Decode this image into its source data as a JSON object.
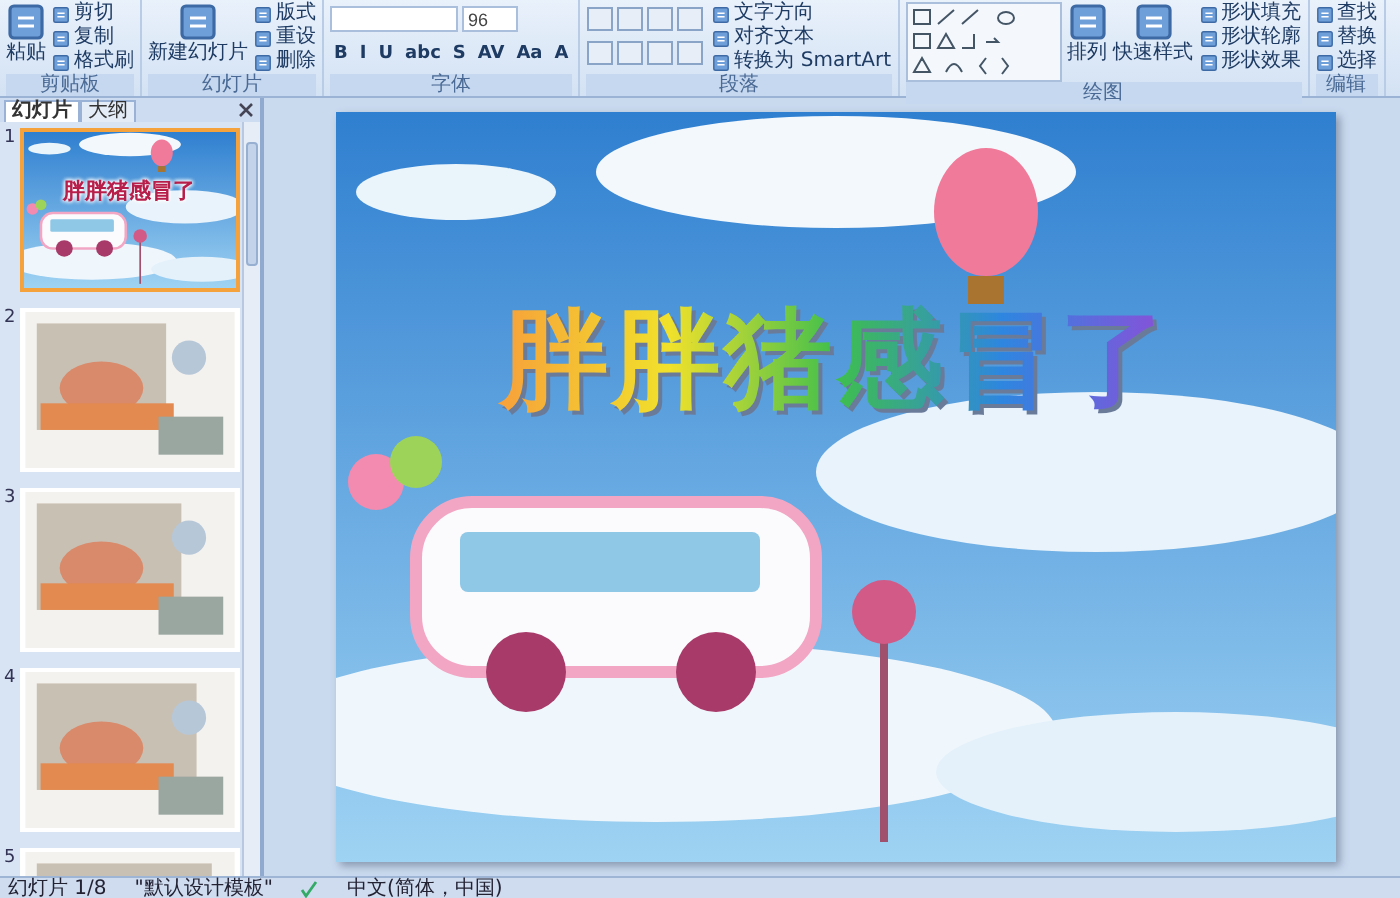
{
  "ribbon": {
    "groups": [
      {
        "label": "剪贴板",
        "columns": [
          [
            {
              "kind": "large",
              "label": "粘贴"
            }
          ],
          [
            {
              "kind": "small",
              "label": "剪切"
            },
            {
              "kind": "small",
              "label": "复制"
            },
            {
              "kind": "small",
              "label": "格式刷"
            }
          ]
        ]
      },
      {
        "label": "幻灯片",
        "columns": [
          [
            {
              "kind": "large",
              "label": "新建幻灯片"
            }
          ],
          [
            {
              "kind": "small",
              "label": "版式"
            },
            {
              "kind": "small",
              "label": "重设"
            },
            {
              "kind": "small",
              "label": "删除"
            }
          ]
        ]
      },
      {
        "label": "字体",
        "columns": [
          [
            {
              "kind": "fontbar",
              "size": "96"
            },
            {
              "kind": "formatbar",
              "buttons": [
                "B",
                "I",
                "U",
                "abc",
                "S",
                "AV",
                "Aa",
                "A"
              ]
            }
          ]
        ]
      },
      {
        "label": "段落",
        "columns": [
          [
            {
              "kind": "iconbar"
            },
            {
              "kind": "iconbar"
            }
          ],
          [
            {
              "kind": "small",
              "label": "文字方向"
            },
            {
              "kind": "small",
              "label": "对齐文本"
            },
            {
              "kind": "small",
              "label": "转换为 SmartArt"
            }
          ]
        ]
      },
      {
        "label": "绘图",
        "columns": [
          [
            {
              "kind": "gallery"
            }
          ],
          [
            {
              "kind": "large",
              "label": "排列"
            }
          ],
          [
            {
              "kind": "large",
              "label": "快速样式"
            }
          ],
          [
            {
              "kind": "small",
              "label": "形状填充"
            },
            {
              "kind": "small",
              "label": "形状轮廓"
            },
            {
              "kind": "small",
              "label": "形状效果"
            }
          ]
        ]
      },
      {
        "label": "编辑",
        "columns": [
          [
            {
              "kind": "small",
              "label": "查找"
            },
            {
              "kind": "small",
              "label": "替换"
            },
            {
              "kind": "small",
              "label": "选择"
            }
          ]
        ]
      }
    ]
  },
  "panel": {
    "tabs": [
      {
        "label": "幻灯片",
        "selected": true
      },
      {
        "label": "大纲",
        "selected": false
      }
    ],
    "thumbnails": [
      {
        "number": "1",
        "selected": true,
        "title": "胖胖猪感冒了"
      },
      {
        "number": "2",
        "selected": false
      },
      {
        "number": "3",
        "selected": false
      },
      {
        "number": "4",
        "selected": false
      },
      {
        "number": "5",
        "selected": false
      }
    ]
  },
  "slide": {
    "title": "胖胖猪感冒了"
  },
  "status_bar": {
    "slide": "幻灯片 1/8",
    "theme": "\"默认设计模板\"",
    "language": "中文(简体，中国)"
  }
}
